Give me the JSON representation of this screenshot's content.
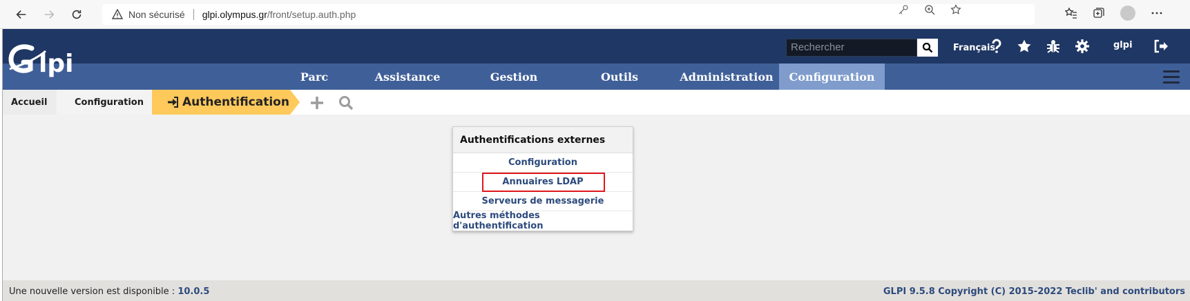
{
  "browser": {
    "insecure_label": "Non sécurisé",
    "url_host": "glpi.olympus.gr",
    "url_path": "/front/setup.auth.php"
  },
  "header": {
    "search_placeholder": "Rechercher",
    "language": "Français",
    "user": "glpi"
  },
  "menu": {
    "items": [
      "Parc",
      "Assistance",
      "Gestion",
      "Outils",
      "Administration",
      "Configuration"
    ],
    "active": "Configuration"
  },
  "breadcrumb": {
    "home": "Accueil",
    "section": "Configuration",
    "current": "Authentification"
  },
  "panel": {
    "title": "Authentifications externes",
    "links": [
      "Configuration",
      "Annuaires LDAP",
      "Serveurs de messagerie",
      "Autres méthodes d'authentification"
    ],
    "highlighted": "Annuaires LDAP"
  },
  "footer": {
    "new_version_text": "Une nouvelle version est disponible :",
    "new_version": "10.0.5",
    "copyright": "GLPI 9.5.8 Copyright (C) 2015-2022 Teclib' and contributors"
  },
  "colors": {
    "header_dark": "#1f3764",
    "menu_bar": "#3f5f98",
    "menu_active": "#7f9ccc",
    "breadcrumb_current": "#ffc95b",
    "link": "#2c4a7c",
    "highlight": "#e0161b"
  }
}
